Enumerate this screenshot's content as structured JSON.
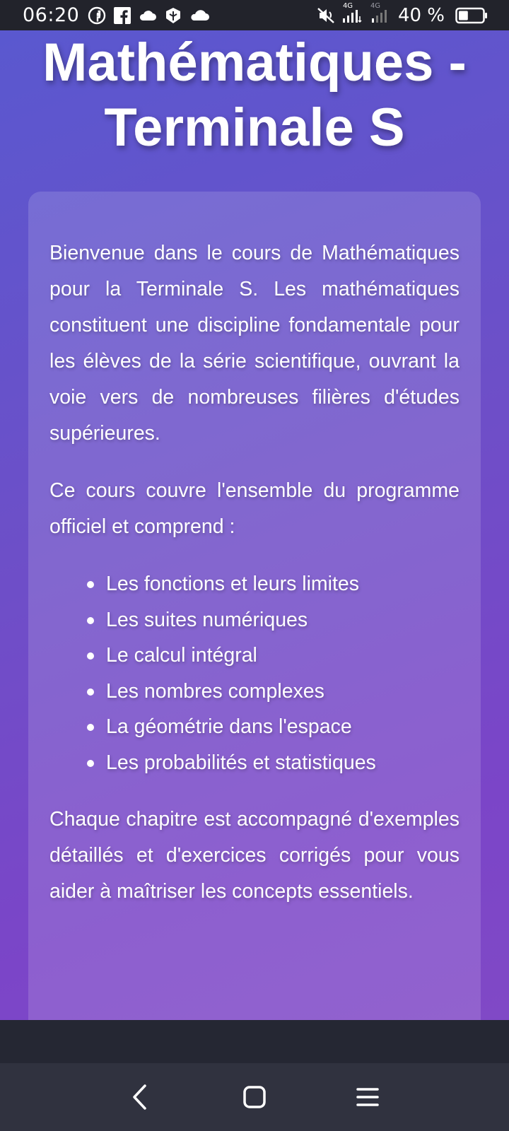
{
  "status_bar": {
    "time": "06:20",
    "left_icons": [
      "messenger-icon",
      "facebook-icon",
      "cloud-icon",
      "shield-icon",
      "cloud-icon"
    ],
    "network_label_1": "4G",
    "network_label_2": "4G",
    "battery_text": "40 %",
    "battery_level": 0.4
  },
  "page": {
    "title": "Mathématiques - Terminale S",
    "intro": "Bienvenue dans le cours de Mathématiques pour la Terminale S. Les mathématiques constituent une discipline fondamentale pour les élèves de la série scientifique, ouvrant la voie vers de nombreuses filières d'études supérieures.",
    "coverage": "Ce cours couvre l'ensemble du programme officiel et comprend :",
    "topics": [
      "Les fonctions et leurs limites",
      "Les suites numériques",
      "Le calcul intégral",
      "Les nombres complexes",
      "La géométrie dans l'espace",
      "Les probabilités et statistiques"
    ],
    "closing": "Chaque chapitre est accompagné d'exemples détaillés et d'exercices corrigés pour vous aider à maîtriser les concepts essentiels."
  },
  "nav_bar": {
    "buttons": [
      "back-icon",
      "home-icon",
      "menu-icon"
    ]
  },
  "colors": {
    "gradient_start": "#5a58cf",
    "gradient_end": "#8049c6",
    "status_bar_bg": "#22232b",
    "nav_bar_bg": "#30323f"
  }
}
